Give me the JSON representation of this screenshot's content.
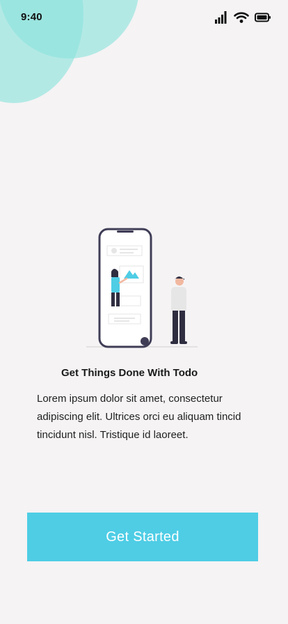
{
  "status_bar": {
    "time": "9:40",
    "icons": [
      "signal-icon",
      "wifi-icon",
      "battery-icon"
    ]
  },
  "colors": {
    "background": "#f5f3f4",
    "accent": "#4ecde5",
    "bubble": "#8fe3dd",
    "button_text": "#ffffff"
  },
  "illustration": {
    "name": "phone-with-people-illustration"
  },
  "onboarding": {
    "title": "Get Things Done With Todo",
    "description": "Lorem ipsum dolor sit amet, consectetur adipiscing elit. Ultrices orci eu aliquam tincid tincidunt nisl. Tristique id laoreet."
  },
  "cta": {
    "label": "Get Started"
  }
}
